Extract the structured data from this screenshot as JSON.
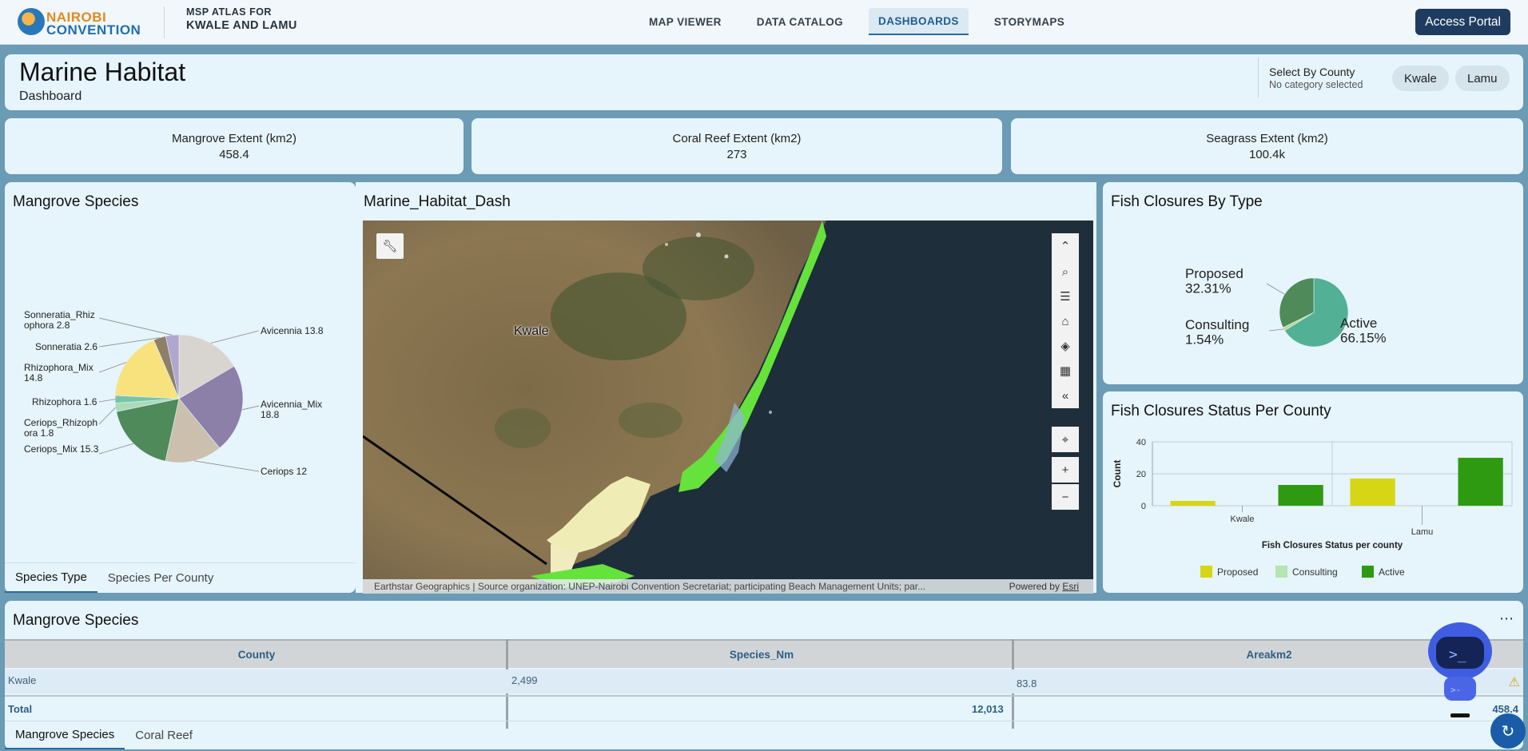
{
  "nav": {
    "logo_line1": "NAIROBI",
    "logo_line2": "CONVENTION",
    "atlas_line1": "MSP ATLAS FOR",
    "atlas_line2": "KWALE AND LAMU",
    "links": [
      "MAP VIEWER",
      "DATA CATALOG",
      "DASHBOARDS",
      "STORYMAPS"
    ],
    "active_link": "DASHBOARDS",
    "portal_button": "Access Portal"
  },
  "header": {
    "title": "Marine Habitat",
    "subtitle": "Dashboard",
    "county_selector_label": "Select By County",
    "county_selector_status": "No category selected",
    "county_chips": [
      "Kwale",
      "Lamu"
    ]
  },
  "indicators": [
    {
      "title": "Mangrove Extent (km2)",
      "value": "458.4"
    },
    {
      "title": "Coral Reef Extent (km2)",
      "value": "273"
    },
    {
      "title": "Seagrass Extent (km2)",
      "value": "100.4k"
    }
  ],
  "mangrove_panel": {
    "title": "Mangrove Species",
    "tabs": [
      "Species Type",
      "Species Per County"
    ],
    "active_tab": "Species Type"
  },
  "map_panel": {
    "title": "Marine_Habitat_Dash",
    "place_label": "Kwale",
    "attribution": "Earthstar Geographics | Source organization: UNEP-Nairobi Convention Secretariat; participating Beach Management Units; par...",
    "powered_by": "Powered by",
    "powered_by_link": "Esri",
    "tools": [
      "wrench-icon",
      "collapse-up-icon",
      "search-icon",
      "legend-list-icon",
      "home-icon",
      "layers-icon",
      "qr-code-icon",
      "collapse-left-icon",
      "locate-icon",
      "zoom-in-icon",
      "zoom-out-icon"
    ]
  },
  "fish_type_panel": {
    "title": "Fish Closures By Type"
  },
  "fish_status_panel": {
    "title": "Fish Closures Status Per County"
  },
  "table_panel": {
    "title": "Mangrove Species",
    "columns": [
      "County",
      "Species_Nm",
      "Areakm2"
    ],
    "rows": [
      [
        "Kwale",
        "2,499",
        "83.8"
      ]
    ],
    "total_label": "Total",
    "total_species": "12,013",
    "total_area": "458.4",
    "tabs": [
      "Mangrove Species",
      "Coral Reef"
    ],
    "active_tab": "Mangrove Species",
    "menu_icon": "more-options-icon"
  },
  "chart_data": [
    {
      "type": "pie",
      "categories": [
        "Avicennia",
        "Avicennia_Mix",
        "Ceriops",
        "Ceriops_Mix",
        "Ceriops_Rhizophora",
        "Rhizophora",
        "Rhizophora_Mix",
        "Sonneratia",
        "Sonneratia_Rhizophora"
      ],
      "labels": [
        "Avicennia 13.8",
        "Avicennia_Mix 18.8",
        "Ceriops 12",
        "Ceriops_Mix 15.3",
        "Ceriops_Rhizoph ora 1.8",
        "Rhizophora 1.6",
        "Rhizophora_Mix 14.8",
        "Sonneratia 2.6",
        "Sonneratia_Rhiz ophora 2.8"
      ],
      "values": [
        13.8,
        18.8,
        12,
        15.3,
        1.8,
        1.6,
        14.8,
        2.6,
        2.8
      ],
      "colors": [
        "#d8d4d0",
        "#8c7fa8",
        "#cbbfae",
        "#4f8a5a",
        "#a9dcb7",
        "#78c4a8",
        "#f7e27d",
        "#8e7f68",
        "#b0a6d0"
      ]
    },
    {
      "type": "pie",
      "categories": [
        "Active",
        "Consulting",
        "Proposed"
      ],
      "labels": [
        "Active 66.15%",
        "Consulting 1.54%",
        "Proposed 32.31%"
      ],
      "values": [
        66.15,
        1.54,
        32.31
      ],
      "colors": [
        "#52b095",
        "#b9d98e",
        "#4f8a5a"
      ]
    },
    {
      "type": "bar",
      "categories": [
        "Kwale",
        "Lamu"
      ],
      "series": [
        {
          "name": "Proposed",
          "values": [
            3,
            17
          ],
          "color": "#d6d614"
        },
        {
          "name": "Consulting",
          "values": [
            0,
            0
          ],
          "color": "#b5e5b0"
        },
        {
          "name": "Active",
          "values": [
            13,
            30
          ],
          "color": "#2e9a12"
        }
      ],
      "title": "Fish Closures Status per county",
      "ylabel": "Count",
      "ylim": [
        0,
        40
      ],
      "yticks": [
        0,
        20,
        40
      ],
      "legend": "bottom"
    }
  ]
}
